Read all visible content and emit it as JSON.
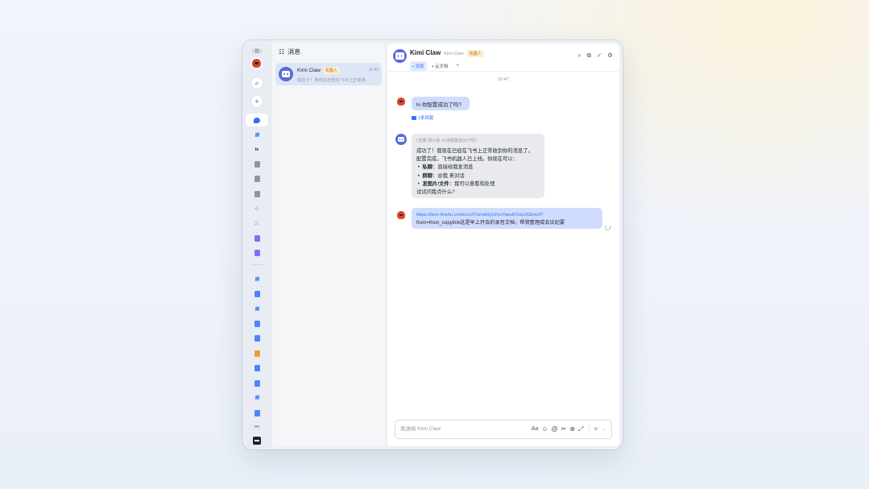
{
  "app": {
    "window_badge": "⊡",
    "more_dots": "•••"
  },
  "sidebar": {
    "items": [
      {
        "kind": "icon-search",
        "symbol": "⌕"
      },
      {
        "kind": "icon-plus",
        "symbol": "+"
      },
      {
        "kind": "messages",
        "active": true
      },
      {
        "kind": "wave",
        "symbol": "/\\/\\/"
      },
      {
        "kind": "doc",
        "symbol": "fe"
      },
      {
        "kind": "grey"
      },
      {
        "kind": "grey"
      },
      {
        "kind": "grey"
      },
      {
        "kind": "grid",
        "symbol": "⁘"
      },
      {
        "kind": "grid2",
        "symbol": "⁙"
      },
      {
        "kind": "purple"
      },
      {
        "kind": "purple"
      },
      {
        "kind": "wave",
        "symbol": "/\\/\\/"
      },
      {
        "kind": "blue"
      },
      {
        "kind": "wave",
        "symbol": "/\\/\\/"
      },
      {
        "kind": "blue"
      },
      {
        "kind": "blue"
      },
      {
        "kind": "orange"
      },
      {
        "kind": "blue"
      },
      {
        "kind": "blue"
      },
      {
        "kind": "wave",
        "symbol": "/\\/\\/"
      },
      {
        "kind": "blue"
      }
    ]
  },
  "message_list": {
    "title": "消息",
    "chats": [
      {
        "name": "Kimi Claw",
        "tag": "机器人",
        "time": "11:43",
        "preview": "成功了！我现在已经在飞书上正常收..."
      }
    ]
  },
  "chat": {
    "name": "Kimi Claw",
    "subtitle": "Kimi Claw",
    "tag": "机器人",
    "tabs": [
      {
        "label": "消息",
        "active": true
      },
      {
        "label": "云文档",
        "active": false
      },
      {
        "label": "+",
        "active": false
      }
    ],
    "header_icons": [
      "search-icon",
      "share-icon",
      "check-icon",
      "settings-icon"
    ],
    "timestamp": "10:47",
    "messages": [
      {
        "from": "user",
        "text": "hi 你配置成功了吗?",
        "reply_count": "1条回复"
      },
      {
        "from": "bot",
        "quote": "| 回复 周小怡: hi 你配置成功了吗?",
        "lines": [
          {
            "text": "成功了！我现在已经在飞书上正常收到你的消息了。"
          },
          {
            "text": "配置完成，飞书机器人已上线。你现在可以："
          },
          {
            "bullet": "私聊",
            "rest": "：直接给我发消息"
          },
          {
            "bullet": "群聊",
            "rest": "：@我 来对话"
          },
          {
            "bullet": "发图片/文件",
            "rest": "：我可以查看和处理"
          },
          {
            "text": "试试问我点什么?"
          }
        ]
      },
      {
        "from": "user",
        "link": "https://llonr.feishu.cn/docx/JYzrndHyhZovYqexKOwcJGkmcf?",
        "text": "from=from_copylink这是早上开会的录音文档，帮我整理成会议纪要"
      }
    ],
    "input": {
      "placeholder": "发送给 Kimi Claw",
      "value": ""
    },
    "input_icons": [
      "Aa",
      "☺",
      "@",
      "✂",
      "⊕",
      "⤢"
    ],
    "send_icon": "➤",
    "dropdown_icon": "⌄"
  },
  "colors": {
    "accent": "#3370ff",
    "bubble_user": "#cfdcfd",
    "bubble_bot": "#e8eaed",
    "bot_avatar": "#5b6bd8",
    "tag_bg": "#fbeed3"
  }
}
